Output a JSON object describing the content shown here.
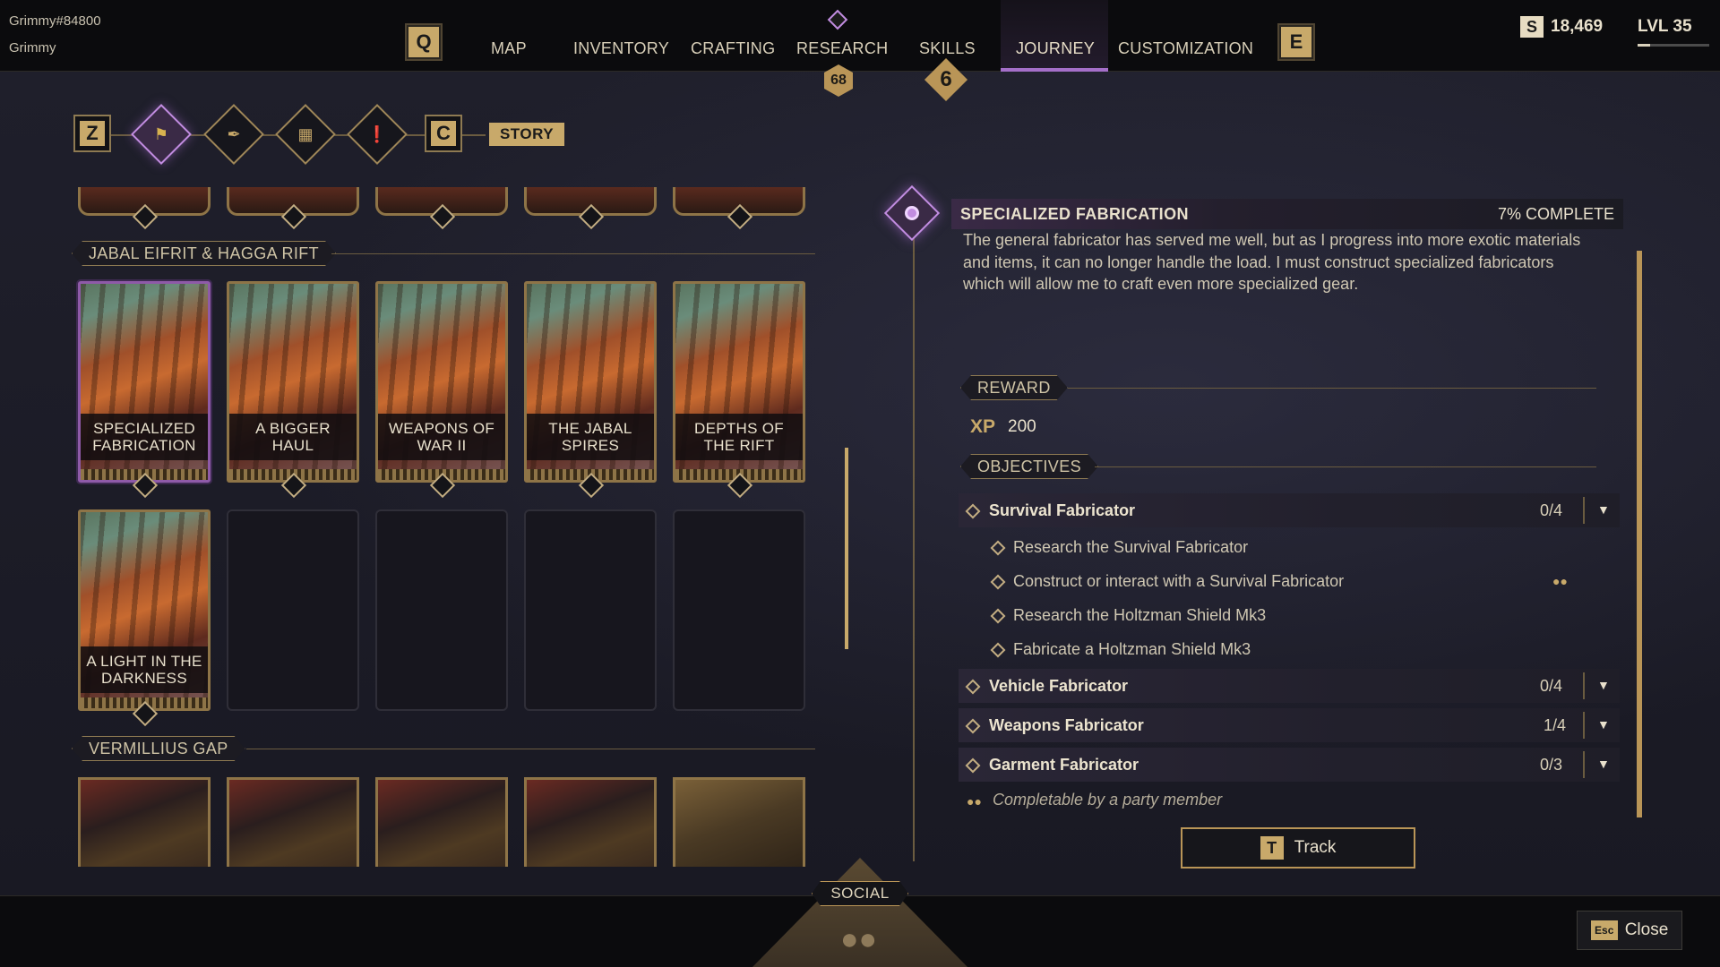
{
  "player": {
    "tag": "Grimmy#84800",
    "name": "Grimmy"
  },
  "nav": {
    "left_key": "Q",
    "right_key": "E",
    "items": [
      {
        "label": "MAP"
      },
      {
        "label": "INVENTORY"
      },
      {
        "label": "CRAFTING"
      },
      {
        "label": "RESEARCH",
        "badge": "68"
      },
      {
        "label": "SKILLS",
        "badge": "6"
      },
      {
        "label": "JOURNEY",
        "active": true
      },
      {
        "label": "CUSTOMIZATION"
      }
    ]
  },
  "currency": {
    "icon": "solari-icon",
    "symbol": "S",
    "value": "18,469"
  },
  "level": {
    "label": "LVL 35",
    "progress": 0.18
  },
  "categories": {
    "left_key": "Z",
    "right_key": "C",
    "active_label": "STORY",
    "icons": [
      "story-banner-icon",
      "quill-icon",
      "book-icon",
      "cards-icon"
    ]
  },
  "sections": [
    {
      "name": "JABAL EIFRIT & HAGGA RIFT",
      "cards": [
        {
          "title_line1": "SPECIALIZED",
          "title_line2": "FABRICATION",
          "selected": true
        },
        {
          "title_line1": "A BIGGER",
          "title_line2": "HAUL"
        },
        {
          "title_line1": "WEAPONS OF",
          "title_line2": "WAR II"
        },
        {
          "title_line1": "THE JABAL",
          "title_line2": "SPIRES"
        },
        {
          "title_line1": "DEPTHS OF",
          "title_line2": "THE RIFT"
        },
        {
          "title_line1": "A LIGHT IN THE",
          "title_line2": "DARKNESS"
        }
      ]
    },
    {
      "name": "VERMILLIUS GAP"
    }
  ],
  "quest": {
    "title": "SPECIALIZED FABRICATION",
    "progress": "7% COMPLETE",
    "description": "The general fabricator has served me well, but as I progress into more exotic materials and items, it can no longer handle the load. I must construct specialized fabricators which will allow me to craft even more specialized gear.",
    "reward_label": "REWARD",
    "reward": {
      "type": "XP",
      "value": "200"
    },
    "objectives_label": "OBJECTIVES",
    "objectives": [
      {
        "title": "Survival Fabricator",
        "count": "0/4",
        "subs": [
          {
            "text": "Research the Survival Fabricator"
          },
          {
            "text": "Construct or interact with a Survival Fabricator",
            "party": true
          },
          {
            "text": "Research the Holtzman Shield Mk3"
          },
          {
            "text": "Fabricate a Holtzman Shield Mk3"
          }
        ]
      },
      {
        "title": "Vehicle Fabricator",
        "count": "0/4"
      },
      {
        "title": "Weapons Fabricator",
        "count": "1/4"
      },
      {
        "title": "Garment Fabricator",
        "count": "0/3"
      }
    ],
    "party_note": "Completable by a party member",
    "track": {
      "key": "T",
      "label": "Track"
    }
  },
  "footer": {
    "social_label": "SOCIAL",
    "close_key": "Esc",
    "close_label": "Close"
  }
}
